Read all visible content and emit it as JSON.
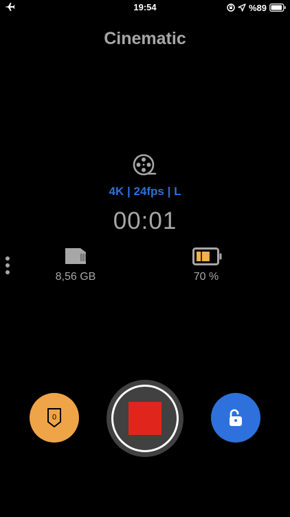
{
  "status_bar": {
    "time": "19:54",
    "battery_percent_label": "%89",
    "icons": [
      "airplane-icon",
      "orientation-lock-icon",
      "location-arrow-icon",
      "battery-icon"
    ]
  },
  "app": {
    "title": "Cinematic"
  },
  "recording": {
    "format_label": "4K | 24fps | L",
    "elapsed": "00:01",
    "format_icon": "film-reel-icon"
  },
  "storage": {
    "free_label": "8,56 GB",
    "icon": "sd-card-icon"
  },
  "device_battery": {
    "label": "70 %",
    "level": 0.7,
    "icon": "battery-icon"
  },
  "controls": {
    "badge_count": "0",
    "record_button_state": "recording",
    "lock_state": "unlocked"
  },
  "colors": {
    "background": "#000000",
    "title_gray": "#a7a7a7",
    "format_blue": "#2f6edb",
    "shield_orange": "#f0a448",
    "stop_red": "#e0261c",
    "lock_blue": "#2e71dc",
    "battery_orange": "#f3b04d"
  }
}
